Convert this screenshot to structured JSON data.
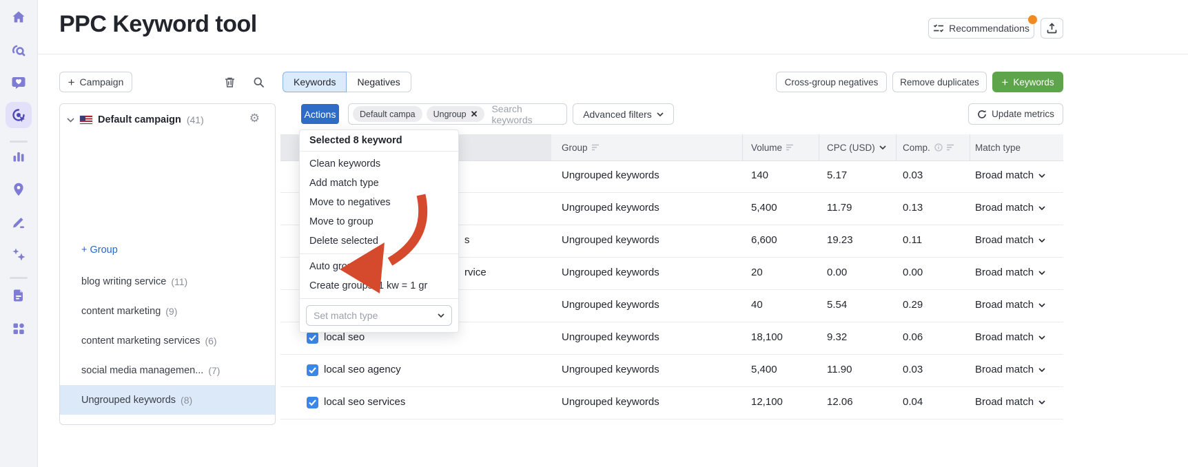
{
  "page": {
    "title": "PPC Keyword tool"
  },
  "topbar": {
    "recommendations_label": "Recommendations",
    "notification_dot_color": "#f18a21"
  },
  "sidebar": {
    "icons": [
      "home-icon",
      "rank-tracker-icon",
      "engagement-icon",
      "ppc-tool-icon",
      "analytics-icon",
      "local-marketing-icon",
      "content-editor-icon",
      "ai-tools-icon",
      "reports-icon",
      "apps-icon"
    ],
    "active_icon": "ppc-tool-icon",
    "accent_color": "#7f7dd3"
  },
  "toolbar": {
    "add_campaign_label": "Campaign",
    "tabs": [
      {
        "label": "Keywords",
        "active": true
      },
      {
        "label": "Negatives",
        "active": false
      }
    ],
    "cross_group_negatives_label": "Cross-group negatives",
    "remove_duplicates_label": "Remove duplicates",
    "add_keywords_label": "Keywords",
    "update_metrics_label": "Update metrics"
  },
  "filter_bar": {
    "actions_label": "Actions",
    "chips": [
      {
        "label": "Default campa"
      },
      {
        "label": "Ungroup"
      }
    ],
    "search_placeholder": "Search keywords",
    "advanced_filters_label": "Advanced filters"
  },
  "campaign_panel": {
    "campaign_name": "Default campaign",
    "campaign_count": "(41)",
    "add_group_label": "+ Group",
    "items": [
      {
        "label": "blog writing service",
        "count": "(11)",
        "selected": false
      },
      {
        "label": "content marketing",
        "count": "(9)",
        "selected": false
      },
      {
        "label": "content marketing services",
        "count": "(6)",
        "selected": false
      },
      {
        "label": "social media managemen...",
        "count": "(7)",
        "selected": false
      },
      {
        "label": "Ungrouped keywords",
        "count": "(8)",
        "selected": true
      }
    ]
  },
  "actions_menu": {
    "header": "Selected 8 keyword",
    "group1": [
      "Clean keywords",
      "Add match type",
      "Move to negatives",
      "Move to group",
      "Delete selected"
    ],
    "group2": [
      "Auto grouping",
      "Create groups: 1 kw = 1 gr"
    ],
    "set_match_type_placeholder": "Set match type"
  },
  "annotation": {
    "color": "#d5492c",
    "highlighted_button": "Actions",
    "arrow_points_to": "Auto grouping"
  },
  "table": {
    "columns": [
      "",
      "Group",
      "Volume",
      "CPC (USD)",
      "Comp.",
      "Match type"
    ],
    "rows": [
      {
        "keyword": "",
        "visible_fragment": "",
        "checked": true,
        "group": "Ungrouped keywords",
        "volume": "140",
        "cpc": "5.17",
        "comp": "0.03",
        "match_type": "Broad match"
      },
      {
        "keyword": "",
        "visible_fragment": "",
        "checked": true,
        "group": "Ungrouped keywords",
        "volume": "5,400",
        "cpc": "11.79",
        "comp": "0.13",
        "match_type": "Broad match"
      },
      {
        "keyword": "",
        "visible_fragment": "s",
        "checked": true,
        "group": "Ungrouped keywords",
        "volume": "6,600",
        "cpc": "19.23",
        "comp": "0.11",
        "match_type": "Broad match"
      },
      {
        "keyword": "",
        "visible_fragment": "rvice",
        "checked": true,
        "group": "Ungrouped keywords",
        "volume": "20",
        "cpc": "0.00",
        "comp": "0.00",
        "match_type": "Broad match"
      },
      {
        "keyword": "",
        "visible_fragment": "",
        "checked": true,
        "group": "Ungrouped keywords",
        "volume": "40",
        "cpc": "5.54",
        "comp": "0.29",
        "match_type": "Broad match"
      },
      {
        "keyword": "local seo",
        "visible_fragment": "",
        "checked": true,
        "group": "Ungrouped keywords",
        "volume": "18,100",
        "cpc": "9.32",
        "comp": "0.06",
        "match_type": "Broad match"
      },
      {
        "keyword": "local seo agency",
        "visible_fragment": "",
        "checked": true,
        "group": "Ungrouped keywords",
        "volume": "5,400",
        "cpc": "11.90",
        "comp": "0.03",
        "match_type": "Broad match"
      },
      {
        "keyword": "local seo services",
        "visible_fragment": "",
        "checked": true,
        "group": "Ungrouped keywords",
        "volume": "12,100",
        "cpc": "12.06",
        "comp": "0.04",
        "match_type": "Broad match"
      }
    ]
  }
}
